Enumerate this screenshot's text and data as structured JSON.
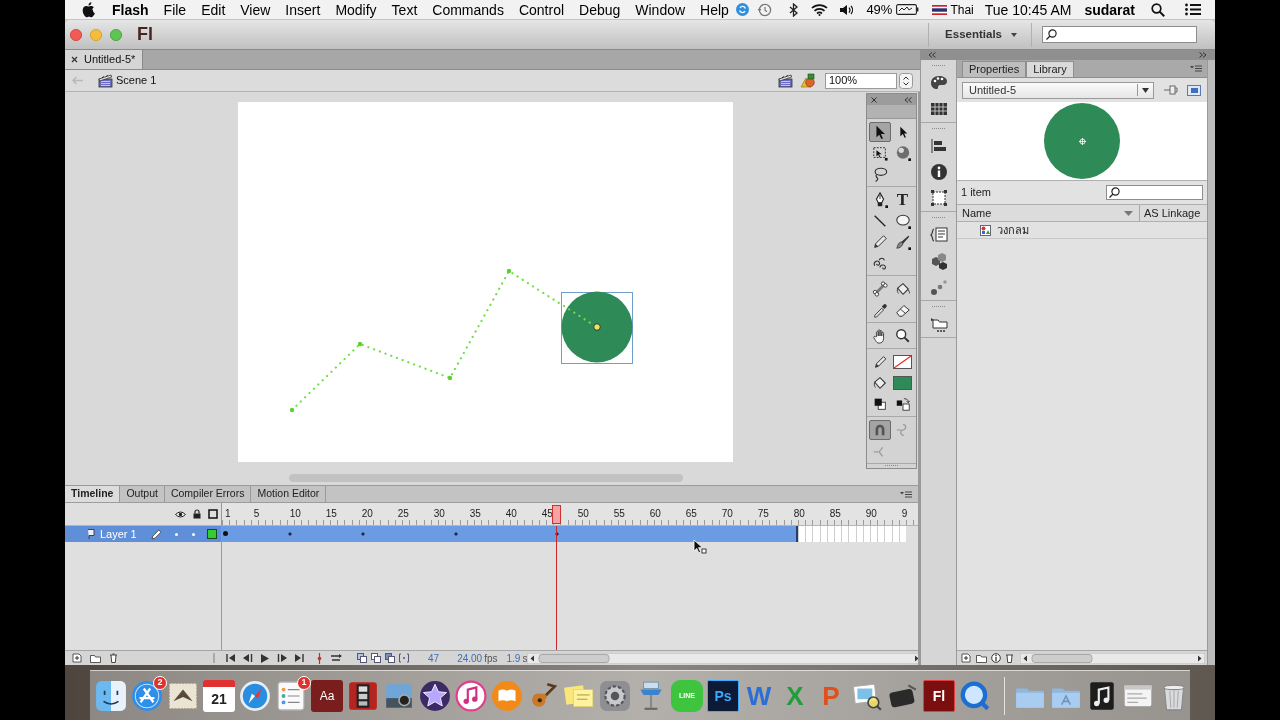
{
  "menu_bar": {
    "app_name": "Flash",
    "items": [
      "File",
      "Edit",
      "View",
      "Insert",
      "Modify",
      "Text",
      "Commands",
      "Control",
      "Debug",
      "Window",
      "Help"
    ],
    "battery": "49%",
    "input_source": "Thai",
    "clock": "Tue 10:45 AM",
    "user": "sudarat"
  },
  "window": {
    "logo": "Fl",
    "workspace": "Essentials"
  },
  "document_tabs": [
    {
      "label": "Untitled-5*",
      "selected": true
    }
  ],
  "edit_bar": {
    "scene": "Scene 1",
    "zoom": "100%"
  },
  "tools_panel": {
    "groups": [
      {
        "tools": [
          {
            "kind": "selection",
            "selected": true
          },
          {
            "kind": "subselection",
            "selected": false
          },
          {
            "kind": "free-transform",
            "selected": false
          },
          {
            "kind": "rotation-3d",
            "selected": false
          },
          {
            "kind": "lasso",
            "selected": false
          }
        ]
      },
      {
        "tools": [
          {
            "kind": "pen",
            "selected": false
          },
          {
            "kind": "text",
            "glyph": "T",
            "selected": false
          },
          {
            "kind": "line",
            "selected": false
          },
          {
            "kind": "oval",
            "selected": false
          },
          {
            "kind": "pencil",
            "selected": false
          },
          {
            "kind": "brush",
            "selected": false
          },
          {
            "kind": "deco",
            "selected": false
          }
        ]
      },
      {
        "tools": [
          {
            "kind": "bone",
            "selected": false
          },
          {
            "kind": "paint-bucket",
            "selected": false
          },
          {
            "kind": "eyedropper",
            "selected": false
          },
          {
            "kind": "eraser",
            "selected": false
          }
        ]
      },
      {
        "tools": [
          {
            "kind": "hand",
            "selected": false
          },
          {
            "kind": "zoom",
            "selected": false
          }
        ]
      },
      {
        "tools": [
          {
            "kind": "stroke-color",
            "selected": false
          },
          {
            "kind": "stroke-swatch",
            "selected": false
          },
          {
            "kind": "fill-color",
            "selected": false
          },
          {
            "kind": "fill-swatch",
            "color": "#2e8b57",
            "selected": false
          },
          {
            "kind": "default-colors",
            "selected": false
          },
          {
            "kind": "swap-colors",
            "selected": false
          }
        ]
      },
      {
        "tools": [
          {
            "kind": "snap",
            "selected": true
          },
          {
            "kind": "smooth",
            "selected": false
          },
          {
            "kind": "straighten",
            "selected": false
          }
        ]
      }
    ]
  },
  "timeline": {
    "tabs": [
      {
        "label": "Timeline",
        "selected": true
      },
      {
        "label": "Output",
        "selected": false
      },
      {
        "label": "Compiler Errors",
        "selected": false
      },
      {
        "label": "Motion Editor",
        "selected": false
      }
    ],
    "frame_labels": [
      "1",
      "5",
      "10",
      "15",
      "20",
      "25",
      "30",
      "35",
      "40",
      "45",
      "50",
      "55",
      "60",
      "65",
      "70",
      "75",
      "80",
      "85",
      "90",
      "9"
    ],
    "layers": [
      {
        "name": "Layer 1",
        "selected": true,
        "color": "#33cc33",
        "tween_span": {
          "level": 0.828
        },
        "keyframes": [
          {
            "kind": "keyframe",
            "level": 0.005
          },
          {
            "kind": "property",
            "level": 0.098
          },
          {
            "kind": "property",
            "level": 0.202
          },
          {
            "kind": "property",
            "level": 0.336
          },
          {
            "kind": "property",
            "level": 0.481
          }
        ]
      }
    ],
    "playhead": {
      "level": 0.481
    },
    "current_frame": "47",
    "frame_rate": "24.00",
    "frame_rate_unit": "fps",
    "elapsed_time": "1.9",
    "elapsed_time_unit": "s"
  },
  "library": {
    "tabs": [
      {
        "label": "Properties",
        "selected": false
      },
      {
        "label": "Library",
        "selected": true
      }
    ],
    "document": "Untitled-5",
    "item_count": "1 item",
    "columns": [
      "Name",
      "AS Linkage"
    ],
    "items": [
      {
        "name": "วงกลม"
      }
    ]
  },
  "dock": {
    "items": [
      {
        "kind": "face"
      },
      {
        "kind": "pencils-circle",
        "badge": "2"
      },
      {
        "kind": "stamp"
      },
      {
        "kind": "calendar",
        "glyph": "21"
      },
      {
        "kind": "compass"
      },
      {
        "kind": "checklist",
        "badge": "1"
      },
      {
        "kind": "dictionary",
        "glyph": "Aa"
      },
      {
        "kind": "photo-strip"
      },
      {
        "kind": "camera"
      },
      {
        "kind": "star"
      },
      {
        "kind": "music-circle"
      },
      {
        "kind": "book-circle"
      },
      {
        "kind": "guitar"
      },
      {
        "kind": "sticky-notes"
      },
      {
        "kind": "gear"
      },
      {
        "kind": "lectern"
      },
      {
        "kind": "chat-bubble",
        "glyph": "LINE"
      },
      {
        "kind": "ps-tile",
        "glyph": "Ps"
      },
      {
        "kind": "big-w",
        "glyph": "W"
      },
      {
        "kind": "big-x",
        "glyph": "X"
      },
      {
        "kind": "big-p",
        "glyph": "P"
      },
      {
        "kind": "photos-loupe"
      },
      {
        "kind": "device"
      },
      {
        "kind": "fl-tile",
        "glyph": "Fl"
      },
      {
        "kind": "ring"
      },
      {
        "kind": "folder"
      },
      {
        "kind": "apps-folder"
      },
      {
        "kind": "music-tile"
      },
      {
        "kind": "document-window"
      },
      {
        "kind": "trash"
      }
    ]
  }
}
